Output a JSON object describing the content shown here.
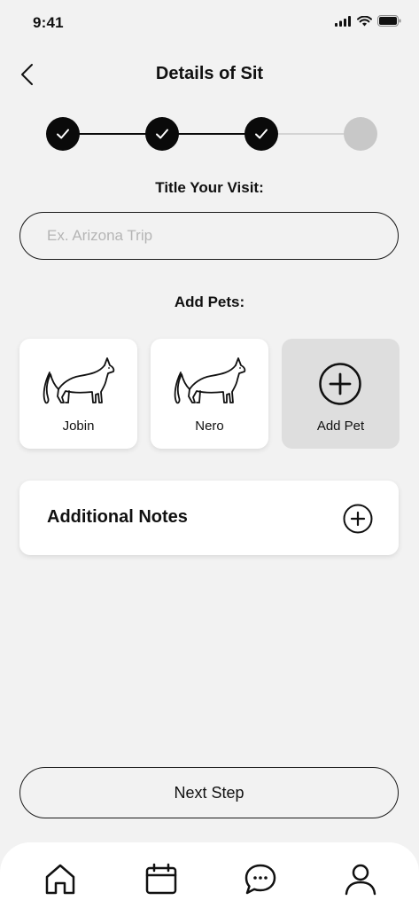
{
  "status_bar": {
    "time": "9:41"
  },
  "header": {
    "title": "Details of Sit"
  },
  "stepper": {
    "total_steps": 4,
    "completed_steps": 3
  },
  "title_section": {
    "label": "Title Your Visit:",
    "input_placeholder": "Ex. Arizona Trip",
    "input_value": ""
  },
  "pets_section": {
    "label": "Add Pets:",
    "pets": [
      {
        "name": "Jobin",
        "icon": "cat-icon"
      },
      {
        "name": "Nero",
        "icon": "cat-icon"
      }
    ],
    "add_label": "Add Pet"
  },
  "notes": {
    "label": "Additional Notes"
  },
  "next_button": {
    "label": "Next Step"
  },
  "tab_bar": {
    "items": [
      {
        "icon": "home-icon"
      },
      {
        "icon": "calendar-icon"
      },
      {
        "icon": "chat-icon"
      },
      {
        "icon": "profile-icon"
      }
    ]
  },
  "colors": {
    "background": "#f2f2f2",
    "step_done": "#0a0a0a",
    "step_todo": "#c8c8c8",
    "card": "#ffffff",
    "add_card": "#dedede",
    "placeholder": "#b5b5b5"
  }
}
